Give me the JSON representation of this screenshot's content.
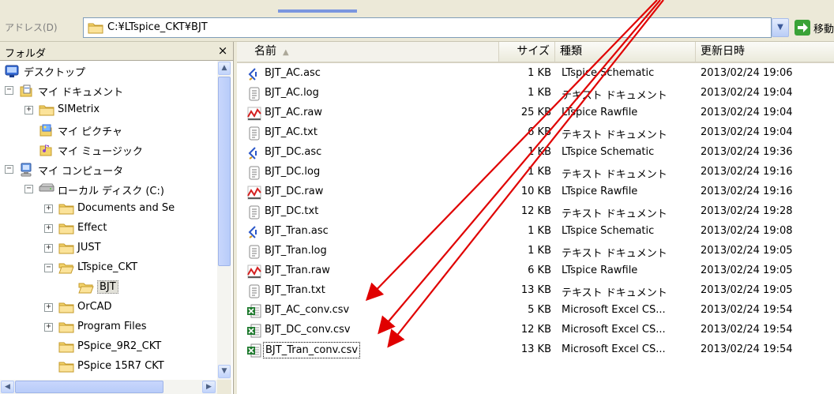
{
  "address": {
    "label": "アドレス(D)",
    "path": "C:¥LTspice_CKT¥BJT",
    "go_label": "移動"
  },
  "folder_pane": {
    "title": "フォルダ",
    "close_symbol": "×",
    "tree": [
      {
        "label": "デスクトップ",
        "icon": "desktop-icon",
        "expander": ""
      },
      {
        "label": "マイ ドキュメント",
        "icon": "my-documents-icon",
        "expander": "−"
      },
      {
        "label": "SIMetrix",
        "icon": "folder-icon",
        "expander": "+"
      },
      {
        "label": "マイ ピクチャ",
        "icon": "my-pictures-icon",
        "expander": ""
      },
      {
        "label": "マイ ミュージック",
        "icon": "my-music-icon",
        "expander": ""
      },
      {
        "label": "マイ コンピュータ",
        "icon": "my-computer-icon",
        "expander": "−"
      },
      {
        "label": "ローカル ディスク (C:)",
        "icon": "local-disk-icon",
        "expander": "−"
      },
      {
        "label": "Documents and Se",
        "icon": "folder-icon",
        "expander": "+"
      },
      {
        "label": "Effect",
        "icon": "folder-icon",
        "expander": "+"
      },
      {
        "label": "JUST",
        "icon": "folder-icon",
        "expander": "+"
      },
      {
        "label": "LTspice_CKT",
        "icon": "folder-open-icon",
        "expander": "−"
      },
      {
        "label": "BJT",
        "icon": "folder-open-icon",
        "expander": "",
        "selected": true
      },
      {
        "label": "OrCAD",
        "icon": "folder-icon",
        "expander": "+"
      },
      {
        "label": "Program Files",
        "icon": "folder-icon",
        "expander": "+"
      },
      {
        "label": "PSpice_9R2_CKT",
        "icon": "folder-icon",
        "expander": ""
      },
      {
        "label": "PSpice 15R7 CKT",
        "icon": "folder-icon",
        "expander": ""
      }
    ]
  },
  "file_list": {
    "columns": {
      "name": "名前",
      "size": "サイズ",
      "type": "種類",
      "date": "更新日時"
    },
    "sort_indicator": "▲",
    "rows": [
      {
        "name": "BJT_AC.asc",
        "size": "1 KB",
        "type": "LTspice Schematic",
        "date": "2013/02/24 19:06",
        "icon": "ltspice-schematic-icon"
      },
      {
        "name": "BJT_AC.log",
        "size": "1 KB",
        "type": "テキスト ドキュメント",
        "date": "2013/02/24 19:04",
        "icon": "text-document-icon"
      },
      {
        "name": "BJT_AC.raw",
        "size": "25 KB",
        "type": "LTspice Rawfile",
        "date": "2013/02/24 19:04",
        "icon": "ltspice-rawfile-icon"
      },
      {
        "name": "BJT_AC.txt",
        "size": "6 KB",
        "type": "テキスト ドキュメント",
        "date": "2013/02/24 19:04",
        "icon": "text-document-icon"
      },
      {
        "name": "BJT_DC.asc",
        "size": "1 KB",
        "type": "LTspice Schematic",
        "date": "2013/02/24 19:36",
        "icon": "ltspice-schematic-icon"
      },
      {
        "name": "BJT_DC.log",
        "size": "1 KB",
        "type": "テキスト ドキュメント",
        "date": "2013/02/24 19:16",
        "icon": "text-document-icon"
      },
      {
        "name": "BJT_DC.raw",
        "size": "10 KB",
        "type": "LTspice Rawfile",
        "date": "2013/02/24 19:16",
        "icon": "ltspice-rawfile-icon"
      },
      {
        "name": "BJT_DC.txt",
        "size": "12 KB",
        "type": "テキスト ドキュメント",
        "date": "2013/02/24 19:28",
        "icon": "text-document-icon"
      },
      {
        "name": "BJT_Tran.asc",
        "size": "1 KB",
        "type": "LTspice Schematic",
        "date": "2013/02/24 19:08",
        "icon": "ltspice-schematic-icon"
      },
      {
        "name": "BJT_Tran.log",
        "size": "1 KB",
        "type": "テキスト ドキュメント",
        "date": "2013/02/24 19:05",
        "icon": "text-document-icon"
      },
      {
        "name": "BJT_Tran.raw",
        "size": "6 KB",
        "type": "LTspice Rawfile",
        "date": "2013/02/24 19:05",
        "icon": "ltspice-rawfile-icon"
      },
      {
        "name": "BJT_Tran.txt",
        "size": "13 KB",
        "type": "テキスト ドキュメント",
        "date": "2013/02/24 19:05",
        "icon": "text-document-icon"
      },
      {
        "name": "BJT_AC_conv.csv",
        "size": "5 KB",
        "type": "Microsoft Excel CS...",
        "date": "2013/02/24 19:54",
        "icon": "excel-csv-icon"
      },
      {
        "name": "BJT_DC_conv.csv",
        "size": "12 KB",
        "type": "Microsoft Excel CS...",
        "date": "2013/02/24 19:54",
        "icon": "excel-csv-icon"
      },
      {
        "name": "BJT_Tran_conv.csv",
        "size": "13 KB",
        "type": "Microsoft Excel CS...",
        "date": "2013/02/24 19:54",
        "icon": "excel-csv-icon",
        "focused": true
      }
    ]
  },
  "colors": {
    "annotation_arrow": "#e00000",
    "toolbar_bg": "#ece9d8",
    "folder_yellow": "#f3d36b"
  }
}
